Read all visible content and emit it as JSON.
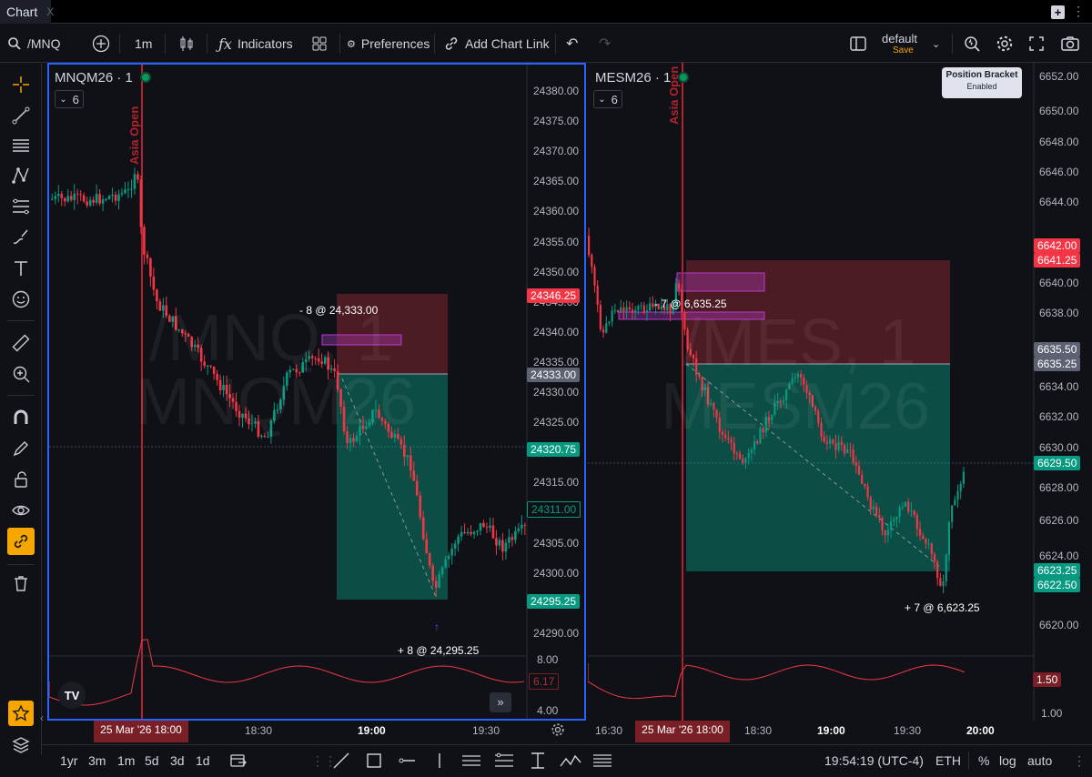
{
  "tabbar": {
    "tab_label": "Chart",
    "close": "X"
  },
  "toolbar": {
    "symbol": "/MNQ",
    "interval": "1m",
    "indicators": "Indicators",
    "preferences": "Preferences",
    "add_chart_link": "Add Chart Link",
    "layout_name": "default",
    "layout_save": "Save"
  },
  "left_chart": {
    "title": "MNQM26 · 1",
    "badge": "6",
    "watermark_line1": "/MNQ, 1",
    "watermark_line2": "MNQM26",
    "session_label": "Asia Open",
    "y_ticks": [
      "24380.00",
      "24375.00",
      "24370.00",
      "24365.00",
      "24360.00",
      "24355.00",
      "24350.00",
      "24345.00",
      "24340.00",
      "24335.00",
      "24330.00",
      "24325.00",
      "24320.00",
      "24315.00",
      "24310.00",
      "24305.00",
      "24300.00",
      "24295.00",
      "24290.00"
    ],
    "price_labels": [
      {
        "text": "24346.25",
        "color": "#f23645"
      },
      {
        "text": "24333.00",
        "color": "#5d6273"
      },
      {
        "text": "24320.75",
        "color": "#089981"
      },
      {
        "text": "24311.00",
        "color": "#0c4d3d"
      },
      {
        "text": "24295.25",
        "color": "#089981"
      }
    ],
    "trade_entry": "- 8 @ 24,333.00",
    "trade_exit": "+ 8 @ 24,295.25",
    "ind_ticks": [
      "8.00",
      "4.00"
    ],
    "ind_value": "6.17",
    "time_labels": [
      "18:30",
      "19:00",
      "19:30"
    ],
    "time_cursor": "25 Mar '26 18:00"
  },
  "right_chart": {
    "title": "MESM26 · 1",
    "badge": "6",
    "watermark_line1": "/MES, 1",
    "watermark_line2": "MESM26",
    "session_label": "Asia Open",
    "y_ticks": [
      "6652.00",
      "6650.00",
      "6648.00",
      "6646.00",
      "6644.00",
      "6640.00",
      "6638.00",
      "6634.00",
      "6632.00",
      "6630.00",
      "6628.00",
      "6626.00",
      "6624.00",
      "6620.00"
    ],
    "price_labels": [
      {
        "text": "6642.00",
        "color": "#f23645"
      },
      {
        "text": "6641.25",
        "color": "#f23645"
      },
      {
        "text": "6635.50",
        "color": "#5d6273"
      },
      {
        "text": "6635.25",
        "color": "#5d6273"
      },
      {
        "text": "6629.50",
        "color": "#089981"
      },
      {
        "text": "6623.25",
        "color": "#089981"
      },
      {
        "text": "6622.50",
        "color": "#089981"
      }
    ],
    "trade_entry": "- 7 @ 6,635.25",
    "trade_exit": "+ 7 @ 6,623.25",
    "ind_ticks": [
      "1.00"
    ],
    "ind_value": "1.50",
    "time_labels": [
      "16:30",
      "18:30",
      "19:00",
      "19:30",
      "20:00"
    ],
    "time_cursor": "25 Mar '26 18:00",
    "position_bracket": {
      "title": "Position Bracket",
      "status": "Enabled"
    }
  },
  "bottom": {
    "ranges": [
      "1yr",
      "3m",
      "1m",
      "5d",
      "3d",
      "1d"
    ],
    "clock": "19:54:19 (UTC-4)",
    "session": "ETH",
    "percent": "%",
    "log": "log",
    "auto": "auto"
  },
  "colors": {
    "up": "#089981",
    "down": "#f23645",
    "accent": "#2962ff",
    "session_line": "#b5222d",
    "highlight": "#f7a600"
  }
}
